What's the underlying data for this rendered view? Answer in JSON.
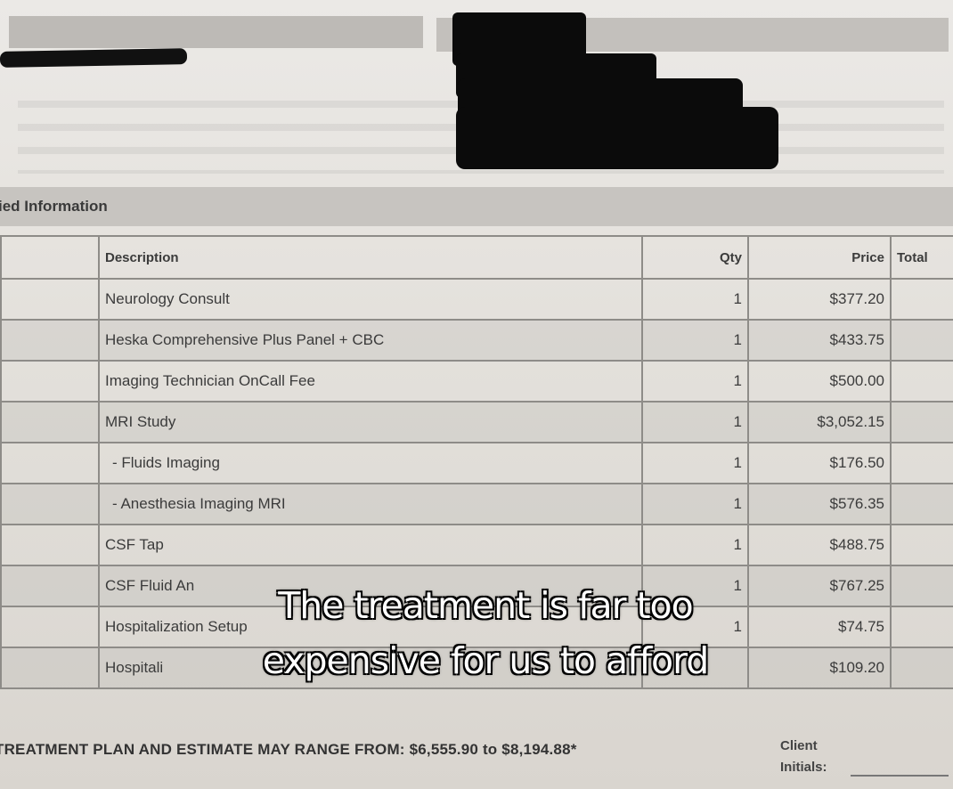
{
  "document": {
    "section_title": "ied Information",
    "columns": {
      "description": "Description",
      "qty": "Qty",
      "price": "Price",
      "total": "Total"
    },
    "rows": [
      {
        "description": "Neurology Consult",
        "qty": "1",
        "price": "$377.20"
      },
      {
        "description": "Heska Comprehensive Plus Panel + CBC",
        "qty": "1",
        "price": "$433.75"
      },
      {
        "description": "Imaging Technician OnCall Fee",
        "qty": "1",
        "price": "$500.00"
      },
      {
        "description": "MRI Study",
        "qty": "1",
        "price": "$3,052.15"
      },
      {
        "description": "- Fluids Imaging",
        "qty": "1",
        "price": "$176.50"
      },
      {
        "description": "- Anesthesia Imaging MRI",
        "qty": "1",
        "price": "$576.35"
      },
      {
        "description": "CSF Tap",
        "qty": "1",
        "price": "$488.75"
      },
      {
        "description": "CSF Fluid An",
        "qty": "1",
        "price": "$767.25"
      },
      {
        "description": "Hospitalization Setup",
        "qty": "1",
        "price": "$74.75"
      },
      {
        "description": "Hospitali",
        "qty": "",
        "price": "$109.20"
      }
    ],
    "footer": {
      "estimate_text": "TREATMENT PLAN AND ESTIMATE MAY RANGE FROM:  $6,555.90 to  $8,194.88*",
      "client_label": "Client",
      "initials_label": "Initials:"
    }
  },
  "caption": {
    "line1": "The treatment is far too",
    "line2": "expensive for us to afford"
  }
}
